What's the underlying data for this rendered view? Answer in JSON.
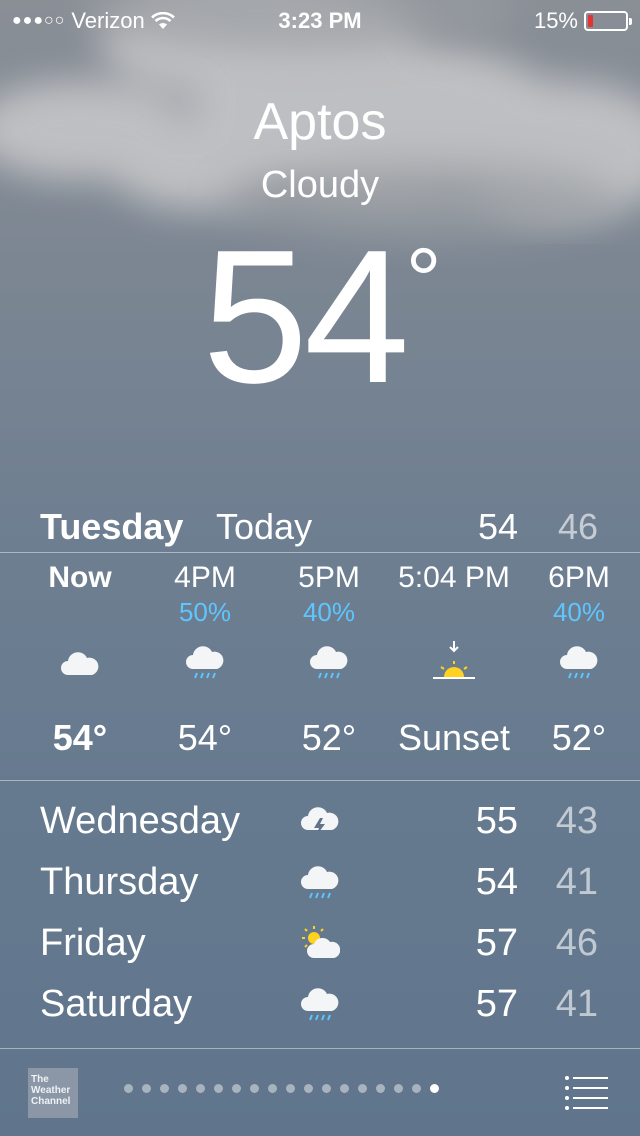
{
  "status_bar": {
    "signal": "●●●○○",
    "carrier": "Verizon",
    "time": "3:23 PM",
    "battery_pct": "15%",
    "battery_level": 0.15,
    "battery_color": "#e33333"
  },
  "location": {
    "city": "Aptos",
    "condition": "Cloudy",
    "temperature": "54",
    "degree": "°"
  },
  "today": {
    "day": "Tuesday",
    "label": "Today",
    "high": "54",
    "low": "46"
  },
  "hourly": [
    {
      "time": "Now",
      "pop": "",
      "icon": "cloud-icon",
      "temp": "54°"
    },
    {
      "time": "4PM",
      "pop": "50%",
      "icon": "rain-cloud-icon",
      "temp": "54°"
    },
    {
      "time": "5PM",
      "pop": "40%",
      "icon": "rain-cloud-icon",
      "temp": "52°"
    },
    {
      "time": "5:04 PM",
      "pop": "",
      "icon": "sunset-icon",
      "temp": "Sunset"
    },
    {
      "time": "6PM",
      "pop": "40%",
      "icon": "rain-cloud-icon",
      "temp": "52°"
    }
  ],
  "daily": [
    {
      "day": "Wednesday",
      "icon": "thunderstorm-icon",
      "high": "55",
      "low": "43"
    },
    {
      "day": "Thursday",
      "icon": "rain-cloud-icon",
      "high": "54",
      "low": "41"
    },
    {
      "day": "Friday",
      "icon": "partly-sunny-icon",
      "high": "57",
      "low": "46"
    },
    {
      "day": "Saturday",
      "icon": "rain-cloud-icon",
      "high": "57",
      "low": "41"
    }
  ],
  "footer": {
    "logo_text": "The Weather Channel",
    "page_count": 18,
    "active_page": 18
  },
  "colors": {
    "precip_blue": "#5ec5ff",
    "sun_yellow": "#ffd21f"
  }
}
